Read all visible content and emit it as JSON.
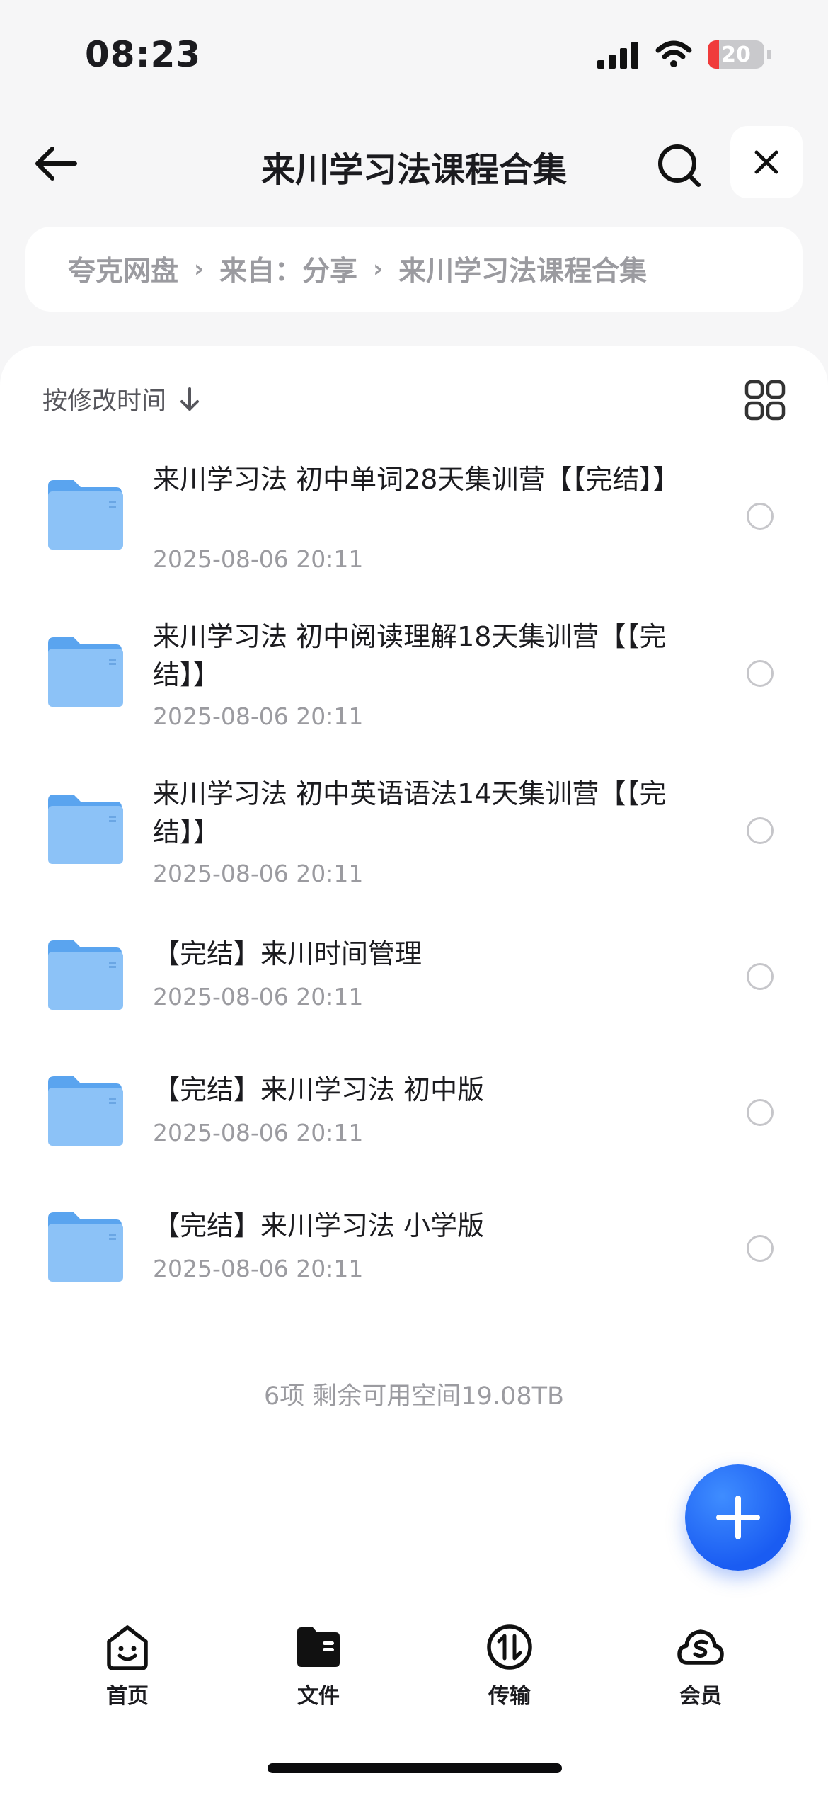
{
  "status_bar": {
    "time": "08:23",
    "battery_text": "20",
    "battery_level": 0.2
  },
  "header": {
    "title": "来川学习法课程合集"
  },
  "breadcrumb": {
    "items": [
      "夸克网盘",
      "来自：分享",
      "来川学习法课程合集"
    ],
    "separator": "›"
  },
  "sort": {
    "label": "按修改时间"
  },
  "files": [
    {
      "name": "来川学习法 初中单词28天集训营【【完结】】",
      "date": "2025-08-06 20:11"
    },
    {
      "name": "来川学习法 初中阅读理解18天集训营【【完结】】",
      "date": "2025-08-06 20:11"
    },
    {
      "name": "来川学习法 初中英语语法14天集训营【【完结】】",
      "date": "2025-08-06 20:11"
    },
    {
      "name": "【完结】来川时间管理",
      "date": "2025-08-06 20:11"
    },
    {
      "name": "【完结】来川学习法 初中版",
      "date": "2025-08-06 20:11"
    },
    {
      "name": "【完结】来川学习法 小学版",
      "date": "2025-08-06 20:11"
    }
  ],
  "summary": "6项 剩余可用空间19.08TB",
  "bottom_nav": [
    {
      "label": "首页",
      "icon": "home-face-icon"
    },
    {
      "label": "文件",
      "icon": "folder-filled-icon"
    },
    {
      "label": "传输",
      "icon": "transfer-icon"
    },
    {
      "label": "会员",
      "icon": "cloud-vip-icon"
    }
  ],
  "colors": {
    "accent": "#1a5cf2",
    "folder": "#7ab8f5",
    "battery_low": "#f03b3b"
  }
}
